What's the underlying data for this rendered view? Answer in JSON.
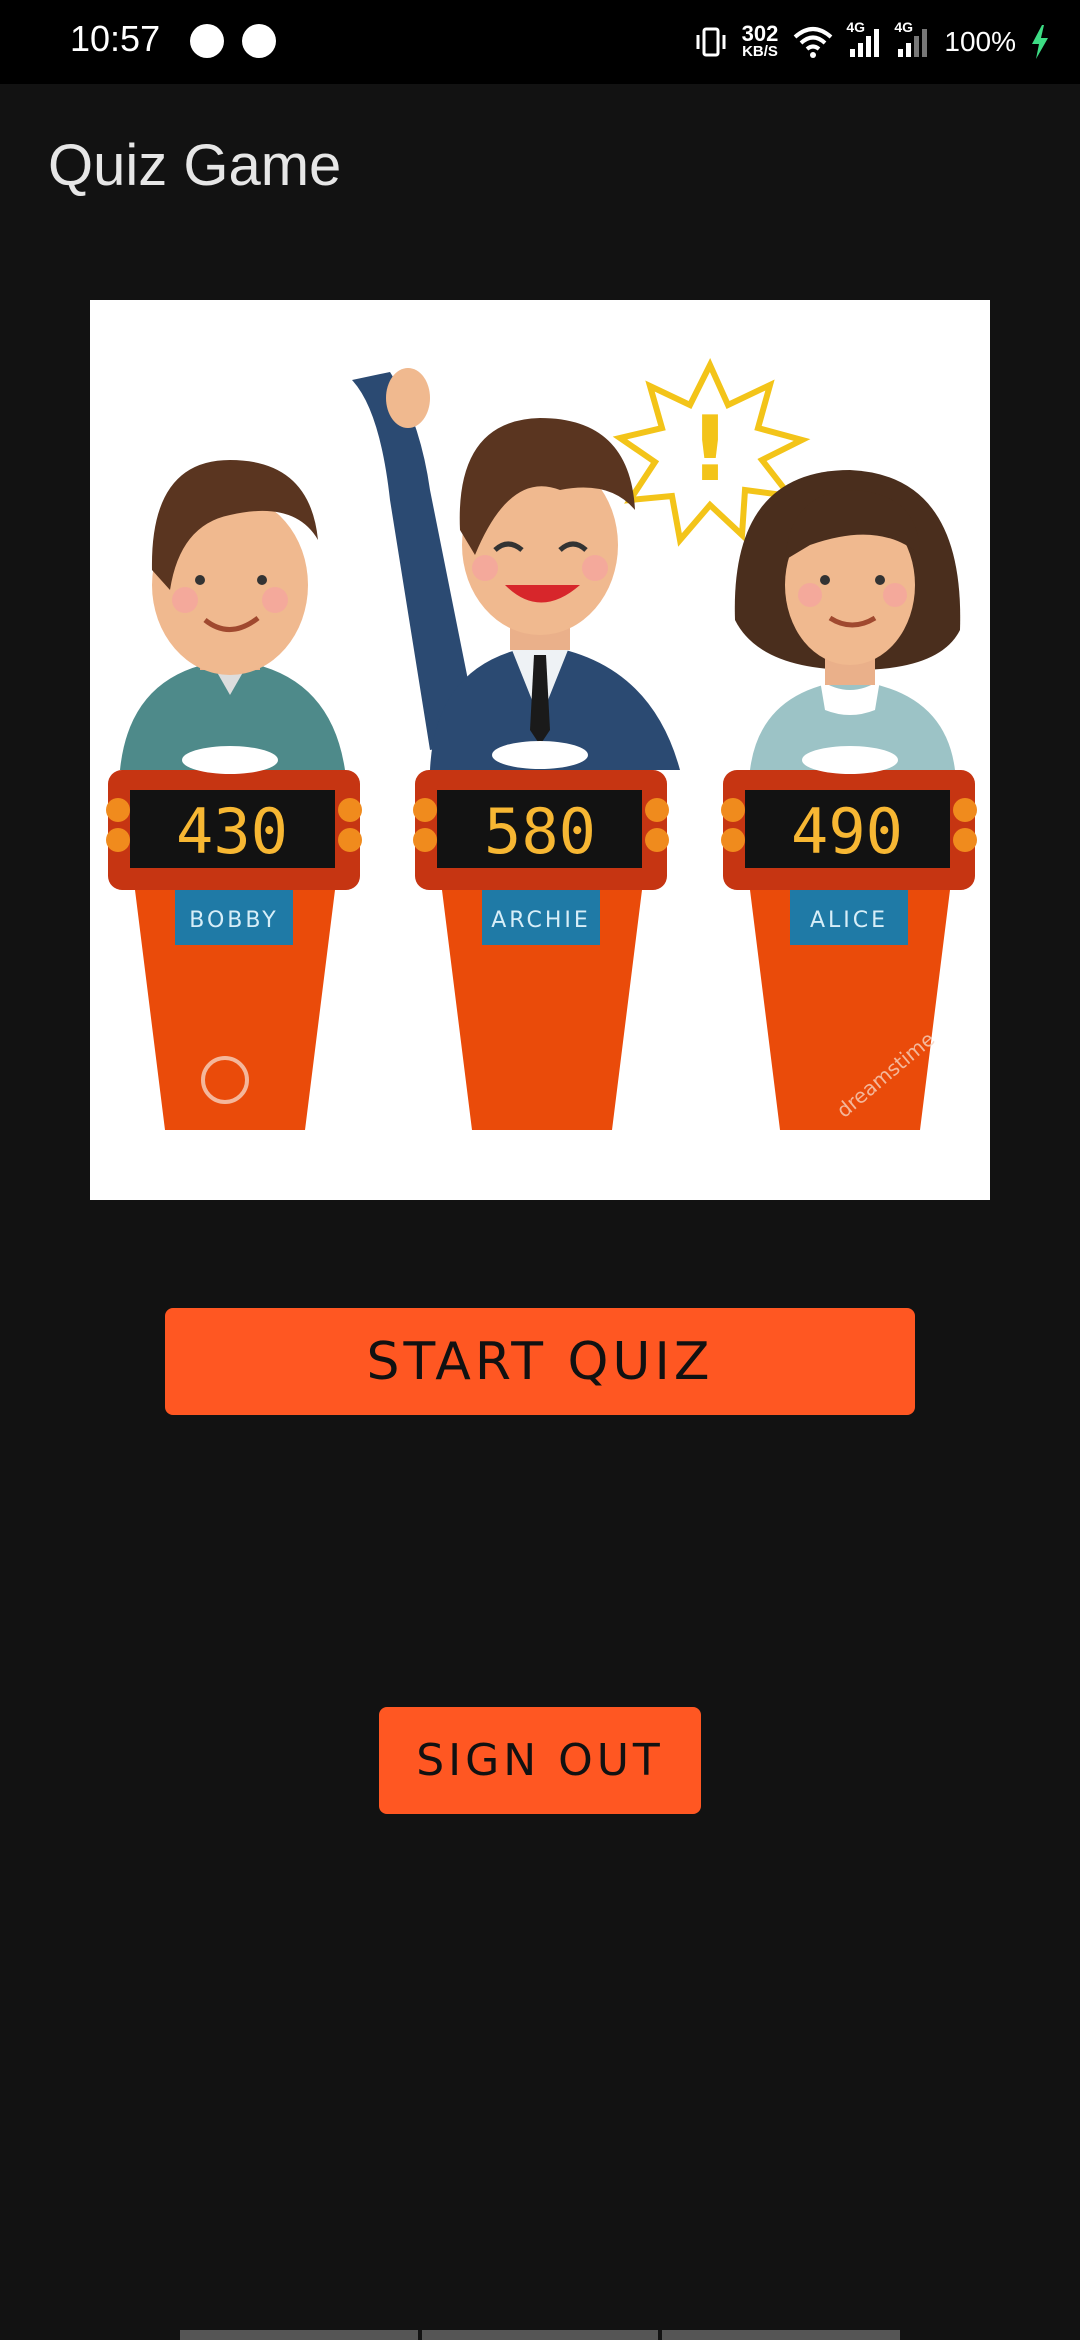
{
  "status_bar": {
    "time": "10:57",
    "net_speed_value": "302",
    "net_speed_unit": "KB/S",
    "signal_1": "4G",
    "signal_2": "4G",
    "battery": "100%",
    "battery_icon_color": "#3ddc84"
  },
  "app": {
    "title": "Quiz Game"
  },
  "hero": {
    "contestants": [
      {
        "name": "BOBBY",
        "score": "430"
      },
      {
        "name": "ARCHIE",
        "score": "580"
      },
      {
        "name": "ALICE",
        "score": "490"
      }
    ],
    "exclamation": "!",
    "watermark": "dreamstime"
  },
  "actions": {
    "start_label": "START QUIZ",
    "signout_label": "SIGN OUT",
    "accent": "#ff5722"
  }
}
